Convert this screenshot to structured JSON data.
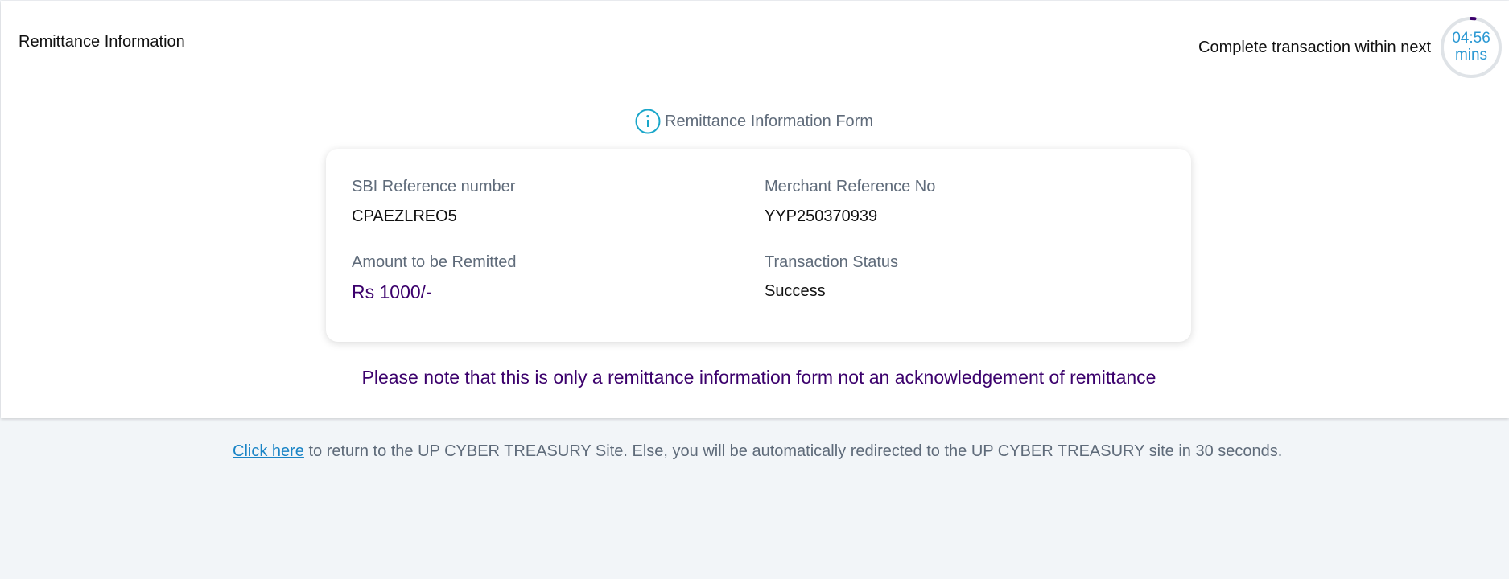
{
  "header": {
    "title": "Remittance Information",
    "timer_message": "Complete transaction within next",
    "timer_value": "04:56",
    "timer_unit": "mins",
    "timer_progress": 0.02
  },
  "form": {
    "heading": "Remittance Information Form",
    "info_icon": "info-circle-icon",
    "fields": [
      {
        "label": "SBI Reference number",
        "value": "CPAEZLREO5"
      },
      {
        "label": "Merchant Reference No",
        "value": "YYP250370939"
      },
      {
        "label": "Amount to be Remitted",
        "value": "Rs 1000/-"
      },
      {
        "label": "Transaction Status",
        "value": "Success"
      }
    ]
  },
  "notice": "Please note that this is only a remittance information form not an acknowledgement of remittance",
  "footer": {
    "link_text": "Click here",
    "message": " to return to the UP CYBER TREASURY Site. Else, you will be automatically redirected to the UP CYBER TREASURY site in 30 seconds."
  },
  "colors": {
    "accent": "#3b006c",
    "link": "#1a84c6",
    "timer": "#2a98d3",
    "label": "#5f6b7a",
    "page_background": "#f2f5f8"
  }
}
